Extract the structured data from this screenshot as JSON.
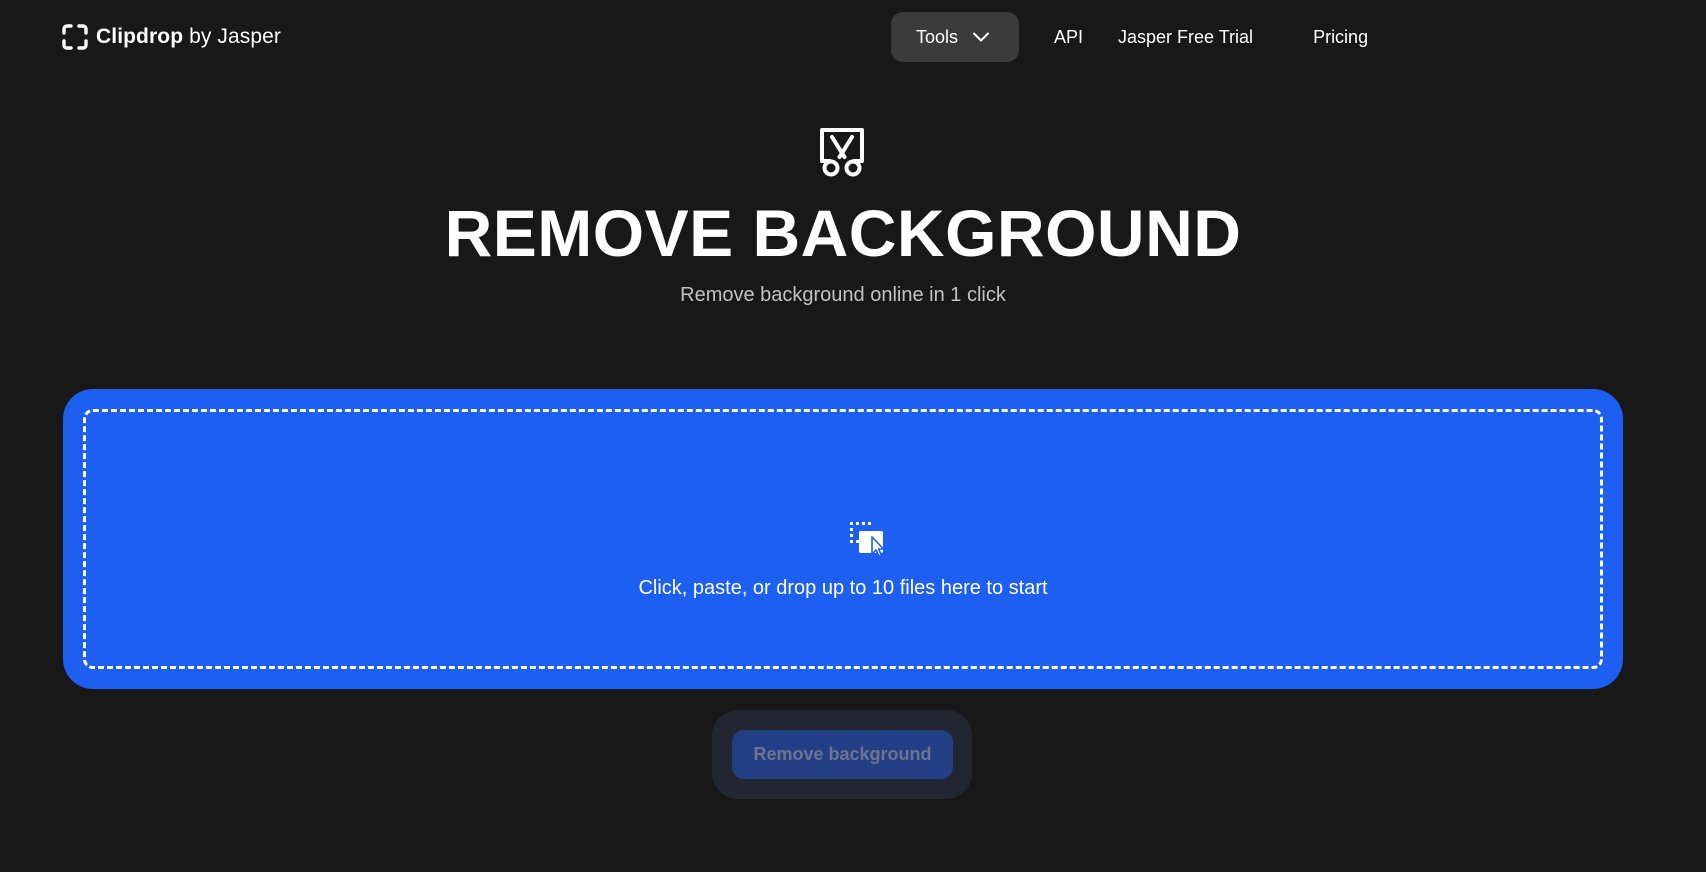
{
  "header": {
    "logo": {
      "brand": "Clipdrop",
      "suffix": "by Jasper",
      "icon": "clipdrop-brackets-icon"
    },
    "nav": {
      "tools_label": "Tools",
      "tools_icon": "chevron-down-icon",
      "links": [
        {
          "label": "API"
        },
        {
          "label": "Jasper Free Trial"
        },
        {
          "label": "Pricing"
        }
      ]
    }
  },
  "hero": {
    "icon": "scissors-cutout-icon",
    "title": "REMOVE BACKGROUND",
    "subtitle": "Remove background online in 1 click"
  },
  "upload": {
    "icon": "drop-file-icon",
    "prompt": "Click, paste, or drop up to 10 files here to start"
  },
  "action": {
    "button_label": "Remove background",
    "enabled": false
  },
  "colors": {
    "background": "#181818",
    "accent": "#1d5ff1",
    "nav_active": "#3b3b3b",
    "button_disabled_bg": "#223e84",
    "button_disabled_text": "#6c7590",
    "subtitle_text": "#c2c2c2"
  }
}
